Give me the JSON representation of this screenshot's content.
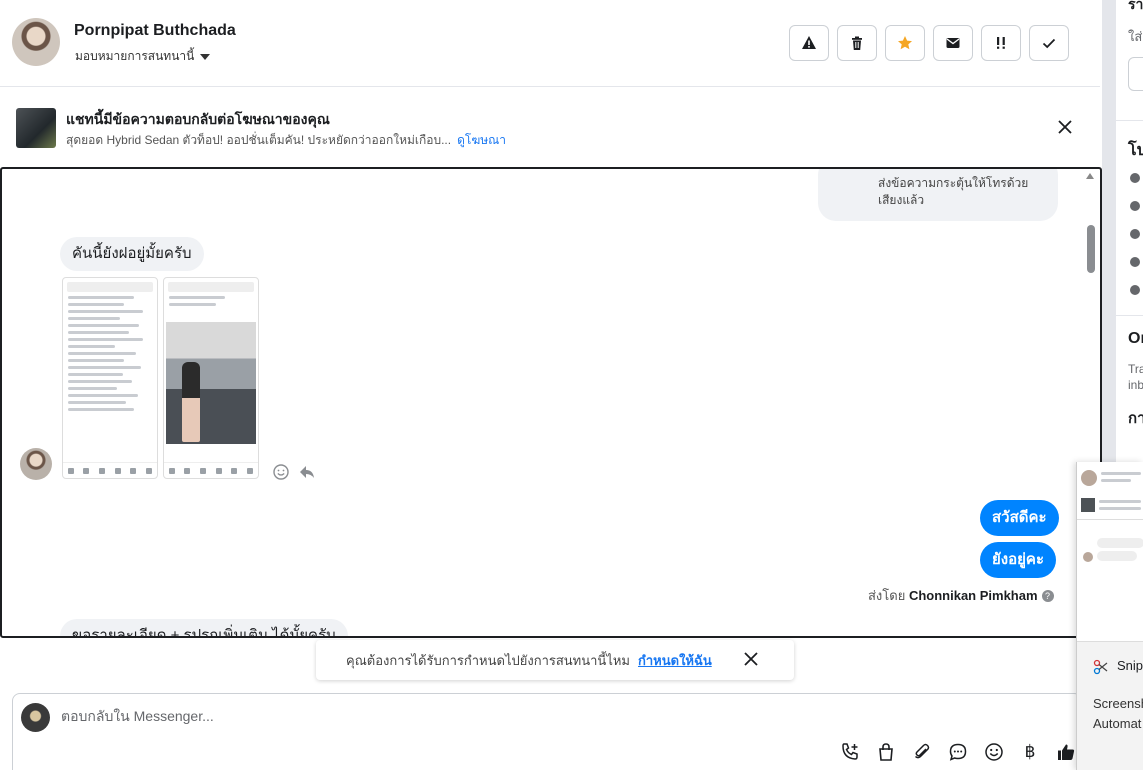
{
  "header": {
    "contact_name": "Pornpipat Buthchada",
    "assign_label": "มอบหมายการสนทนานี้",
    "actions": [
      "spam-icon",
      "trash-icon",
      "star-icon",
      "envelope-icon",
      "important-icon",
      "check-icon"
    ],
    "star_color": "#f5a623"
  },
  "ad_banner": {
    "title": "แชทนี้มีข้อความตอบกลับต่อโฆษณาของคุณ",
    "subtitle": "สุดยอด Hybrid Sedan ตัวท็อป! ออปชั่นเต็มคัน! ประหยัดกว่าออกใหม่เกือบ...",
    "link": "ดูโฆษณา"
  },
  "messages": {
    "outgoing_note_line1": "ส่งข้อความกระตุ้นให้โทรด้วย",
    "outgoing_note_line2": "เสียงแล้ว",
    "incoming_1": "คันนี้ยังฝอยู่มั้ยครับ",
    "outgoing_1": "สวัสดีคะ",
    "outgoing_2": "ยังอยู่คะ",
    "sent_by_prefix": "ส่งโดย",
    "sent_by_name": "Chonnikan Pimkham",
    "incoming_2_partial": "ขอรายละเอียด + รูปรถเพิ่มเติม ได้มั้ยครับ"
  },
  "suggestion": {
    "text": "คุณต้องการได้รับการกำหนดไปยังการสนทนานี้ไหม",
    "action": "กำหนดให้ฉัน"
  },
  "composer": {
    "placeholder": "ตอบกลับใน Messenger...",
    "tools": [
      "phone-plus-icon",
      "shopping-bag-icon",
      "paperclip-icon",
      "chat-bubble-icon",
      "emoji-icon",
      "baht-icon",
      "thumbs-up-icon"
    ],
    "baht_symbol": "฿"
  },
  "right_panel": {
    "fragments": [
      "รา",
      "ใส่",
      "โป",
      "Or",
      "Tra",
      "inb",
      "กา"
    ]
  },
  "snipping_tool": {
    "title": "Snipp",
    "body_line1": "Screensh",
    "body_line2": "Automat"
  },
  "colors": {
    "accent": "#1877f2",
    "outgoing_bubble": "#0084ff",
    "incoming_bubble": "#f0f2f5"
  }
}
